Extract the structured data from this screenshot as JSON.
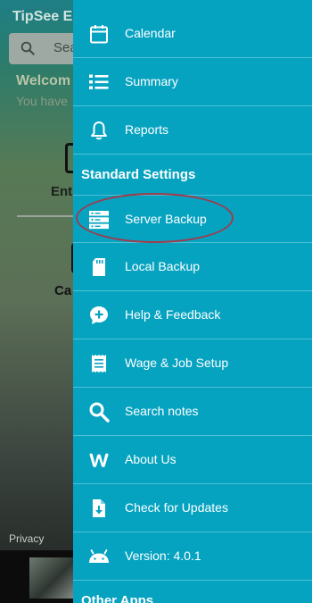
{
  "app": {
    "title": "TipSee E",
    "search_placeholder": "Sea",
    "welcome": "Welcom",
    "subtitle": "You have",
    "enter_label": "Ent",
    "cal_label": "Ca",
    "privacy": "Privacy"
  },
  "drawer": {
    "items_top": [
      {
        "label": "Calendar",
        "icon": "calendar-icon"
      },
      {
        "label": "Summary",
        "icon": "list-icon"
      },
      {
        "label": "Reports",
        "icon": "bell-icon"
      }
    ],
    "section_standard": "Standard Settings",
    "items_settings": [
      {
        "label": "Server Backup",
        "icon": "server-icon"
      },
      {
        "label": "Local Backup",
        "icon": "sd-card-icon"
      },
      {
        "label": "Help & Feedback",
        "icon": "help-chat-icon"
      },
      {
        "label": "Wage & Job Setup",
        "icon": "receipt-icon"
      },
      {
        "label": "Search notes",
        "icon": "search-icon"
      },
      {
        "label": "About Us",
        "icon": "weebly-icon"
      },
      {
        "label": "Check for Updates",
        "icon": "file-download-icon"
      },
      {
        "label": "Version: 4.0.1",
        "icon": "android-icon"
      }
    ],
    "section_other": "Other Apps"
  },
  "colors": {
    "drawer_background": "#06a3c1",
    "divider": "#4ec0d4",
    "highlight_ring": "#a13a4a",
    "text": "#ffffff"
  }
}
